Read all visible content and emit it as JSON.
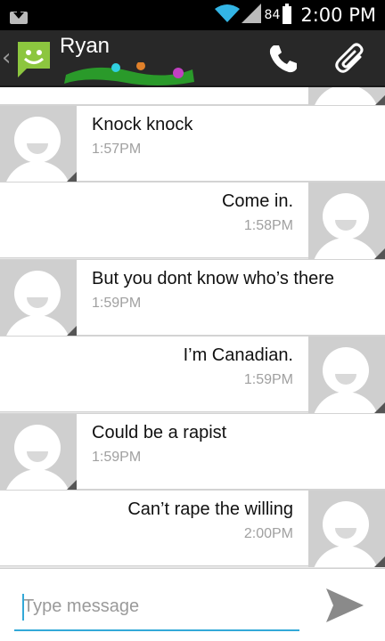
{
  "status_bar": {
    "battery": "84",
    "time": "2:00 PM",
    "icons": [
      "download-icon",
      "wifi-icon",
      "signal-icon",
      "battery-icon"
    ]
  },
  "action_bar": {
    "contact_name": "Ryan",
    "icons": [
      "up-caret-icon",
      "messaging-app-icon",
      "phone-icon",
      "paperclip-icon"
    ]
  },
  "messages": [
    {
      "direction": "out",
      "text": "",
      "time": ""
    },
    {
      "direction": "in",
      "text": "Knock knock",
      "time": "1:57PM"
    },
    {
      "direction": "out",
      "text": "Come in.",
      "time": "1:58PM"
    },
    {
      "direction": "in",
      "text": "But you dont know who’s there",
      "time": "1:59PM"
    },
    {
      "direction": "out",
      "text": "I’m Canadian.",
      "time": "1:59PM"
    },
    {
      "direction": "in",
      "text": "Could be a rapist",
      "time": "1:59PM"
    },
    {
      "direction": "out",
      "text": "Can’t rape the willing",
      "time": "2:00PM"
    }
  ],
  "compose": {
    "placeholder": "Type message",
    "value": ""
  },
  "colors": {
    "accent": "#33a9d8",
    "app_icon_green": "#8cc63f",
    "action_bar": "#282828"
  }
}
